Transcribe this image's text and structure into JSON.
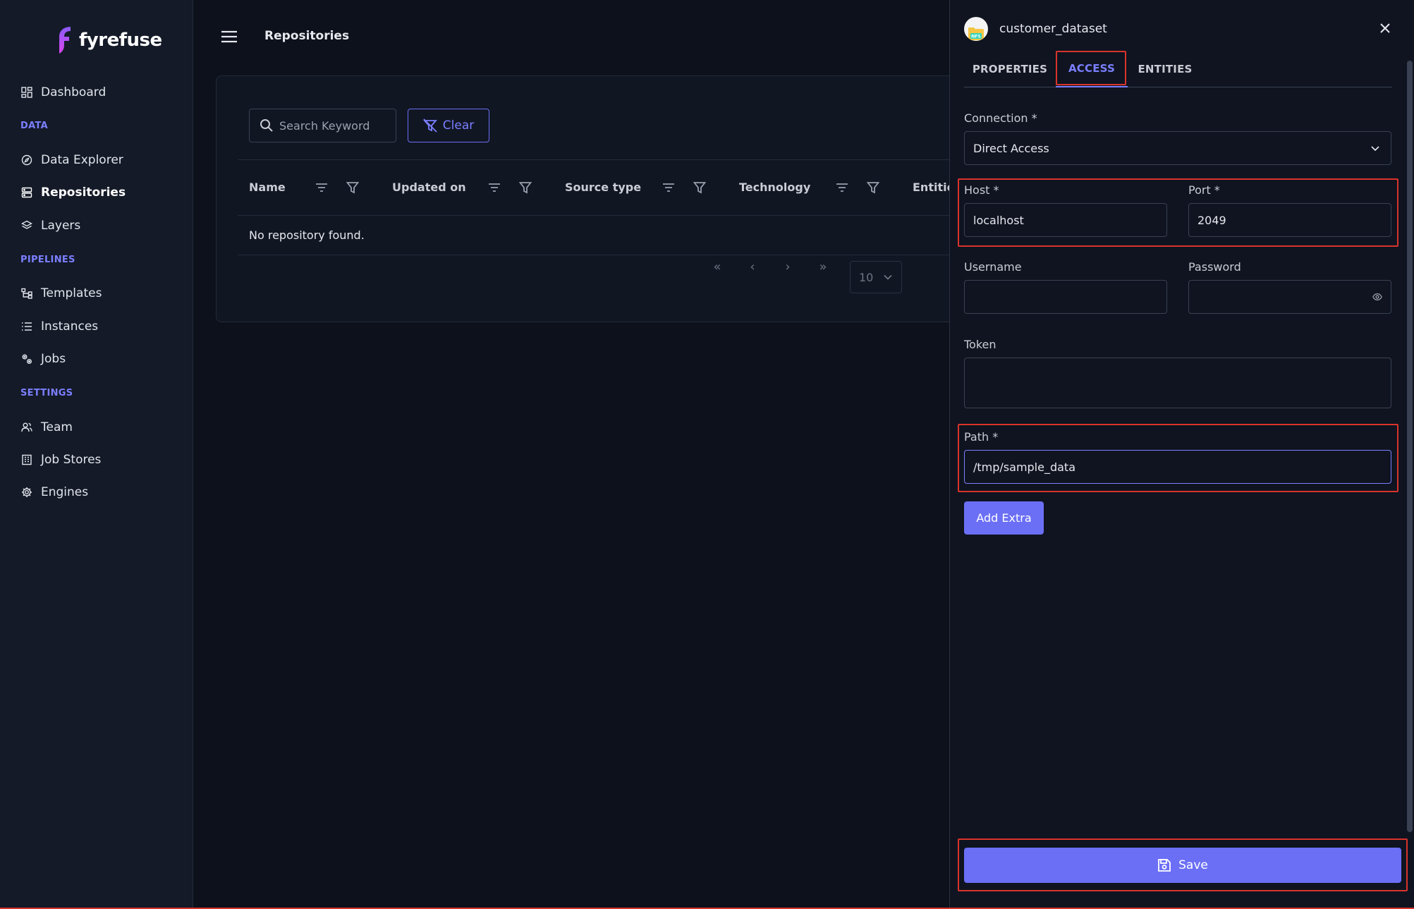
{
  "app": {
    "logo_text": "fyrefuse"
  },
  "sidebar": {
    "items": [
      {
        "label": "Dashboard"
      },
      {
        "section": "DATA"
      },
      {
        "label": "Data Explorer"
      },
      {
        "label": "Repositories",
        "active": true
      },
      {
        "label": "Layers"
      },
      {
        "section": "PIPELINES"
      },
      {
        "label": "Templates"
      },
      {
        "label": "Instances"
      },
      {
        "label": "Jobs"
      },
      {
        "section": "SETTINGS"
      },
      {
        "label": "Team"
      },
      {
        "label": "Job Stores"
      },
      {
        "label": "Engines"
      }
    ]
  },
  "header": {
    "title": "Repositories"
  },
  "toolbar": {
    "search_placeholder": "Search Keyword",
    "clear_label": "Clear"
  },
  "table": {
    "columns": [
      "Name",
      "Updated on",
      "Source type",
      "Technology",
      "Entitie"
    ],
    "empty_message": "No repository found."
  },
  "pagination": {
    "page_size": "10"
  },
  "drawer": {
    "title": "customer_dataset",
    "avatar_text": "NFS",
    "tabs": [
      "PROPERTIES",
      "ACCESS",
      "ENTITIES"
    ],
    "active_tab": "ACCESS",
    "connection": {
      "label": "Connection *",
      "value": "Direct Access"
    },
    "host": {
      "label": "Host *",
      "value": "localhost"
    },
    "port": {
      "label": "Port *",
      "value": "2049"
    },
    "username": {
      "label": "Username",
      "value": ""
    },
    "password": {
      "label": "Password",
      "value": ""
    },
    "token": {
      "label": "Token",
      "value": ""
    },
    "path": {
      "label": "Path *",
      "value": "/tmp/sample_data"
    },
    "add_extra_label": "Add Extra",
    "save_label": "Save"
  },
  "colors": {
    "accent": "#6b6ff5",
    "highlight": "#d9342b",
    "background": "#0d111b",
    "sidebar": "#141a28"
  }
}
